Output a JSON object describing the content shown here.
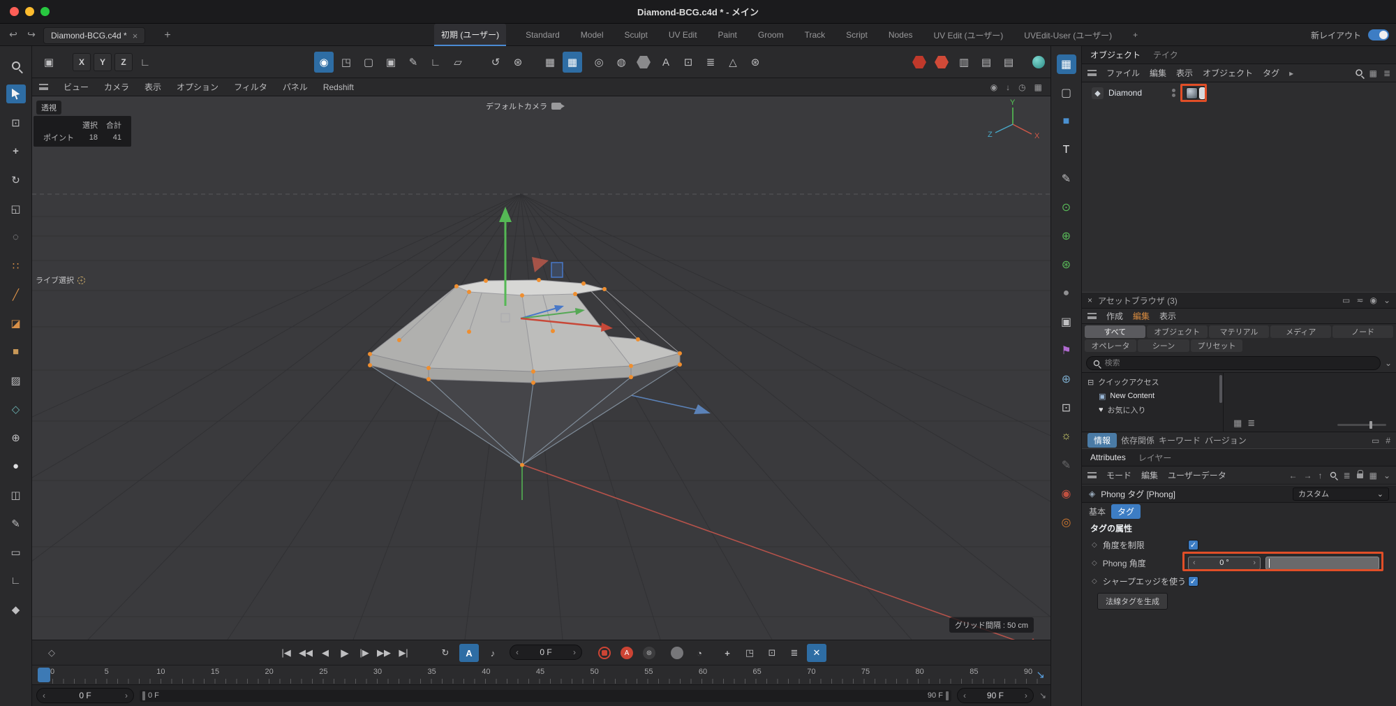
{
  "colors": {
    "accent_blue": "#4b8bd4",
    "annotation_red": "#e14e27",
    "record_red": "#c0392b",
    "viewport_bg": "#3a3a3d"
  },
  "titlebar": {
    "title": "Diamond-BCG.c4d * - メイン"
  },
  "tabrow": {
    "doc_tab": "Diamond-BCG.c4d *",
    "close": "×",
    "add": "+",
    "layouts": [
      "初期 (ユーザー)",
      "Standard",
      "Model",
      "Sculpt",
      "UV Edit",
      "Paint",
      "Groom",
      "Track",
      "Script",
      "Nodes",
      "UV Edit (ユーザー)",
      "UVEdit-User (ユーザー)"
    ],
    "add_layout": "+",
    "new_layout": "新レイアウト"
  },
  "toolbar": {
    "axis_x": "X",
    "axis_y": "Y",
    "axis_z": "Z"
  },
  "viewport_menu": [
    "ビュー",
    "カメラ",
    "表示",
    "オプション",
    "フィルタ",
    "パネル",
    "Redshift"
  ],
  "viewport": {
    "projection": "透視",
    "camera": "デフォルトカメラ",
    "live_selection": "ライブ選択",
    "grid_spacing": "グリッド間隔 : 50 cm",
    "sel_header_selected": "選択",
    "sel_header_total": "合計",
    "sel_row": "ポイント",
    "sel_selected": "18",
    "sel_total": "41",
    "axis_x": "X",
    "axis_y": "Y",
    "axis_z": "Z"
  },
  "transport": {
    "frame": "0 F",
    "autokey_label": "A"
  },
  "timeline": {
    "ticks": [
      "0",
      "5",
      "10",
      "15",
      "20",
      "25",
      "30",
      "35",
      "40",
      "45",
      "50",
      "55",
      "60",
      "65",
      "70",
      "75",
      "80",
      "85",
      "90"
    ],
    "range_start_field": "0 F",
    "range_start_label": "0 F",
    "range_end_label": "90 F",
    "range_end_field": "90 F"
  },
  "object_manager": {
    "tab_objects": "オブジェクト",
    "tab_takes": "テイク",
    "menu": [
      "ファイル",
      "編集",
      "表示",
      "オブジェクト",
      "タグ"
    ],
    "object_name": "Diamond"
  },
  "asset_browser": {
    "close": "×",
    "title": "アセットブラウザ (3)",
    "menu_create": "作成",
    "menu_edit": "編集",
    "menu_view": "表示",
    "tabs1": [
      "すべて",
      "オブジェクト",
      "マテリアル",
      "メディア",
      "ノード"
    ],
    "tabs2": [
      "オペレータ",
      "シーン",
      "プリセット"
    ],
    "search_placeholder": "検索",
    "tree_quick": "クイックアクセス",
    "tree_new_content": "New Content",
    "tree_favorites": "お気に入り",
    "bottom_tabs": [
      "情報",
      "依存関係",
      "キーワード",
      "バージョン"
    ]
  },
  "attributes": {
    "tab_attributes": "Attributes",
    "tab_layers": "レイヤー",
    "menu_mode": "モード",
    "menu_edit": "編集",
    "menu_userdata": "ユーザーデータ",
    "title": "Phong タグ [Phong]",
    "preset": "カスタム",
    "chip_basic": "基本",
    "chip_tag": "タグ",
    "section": "タグの属性",
    "row_limit": "角度を制限",
    "row_phong": "Phong 角度",
    "phong_value": "0 °",
    "row_sharp": "シャープエッジを使う",
    "generate_button": "法線タグを生成"
  }
}
